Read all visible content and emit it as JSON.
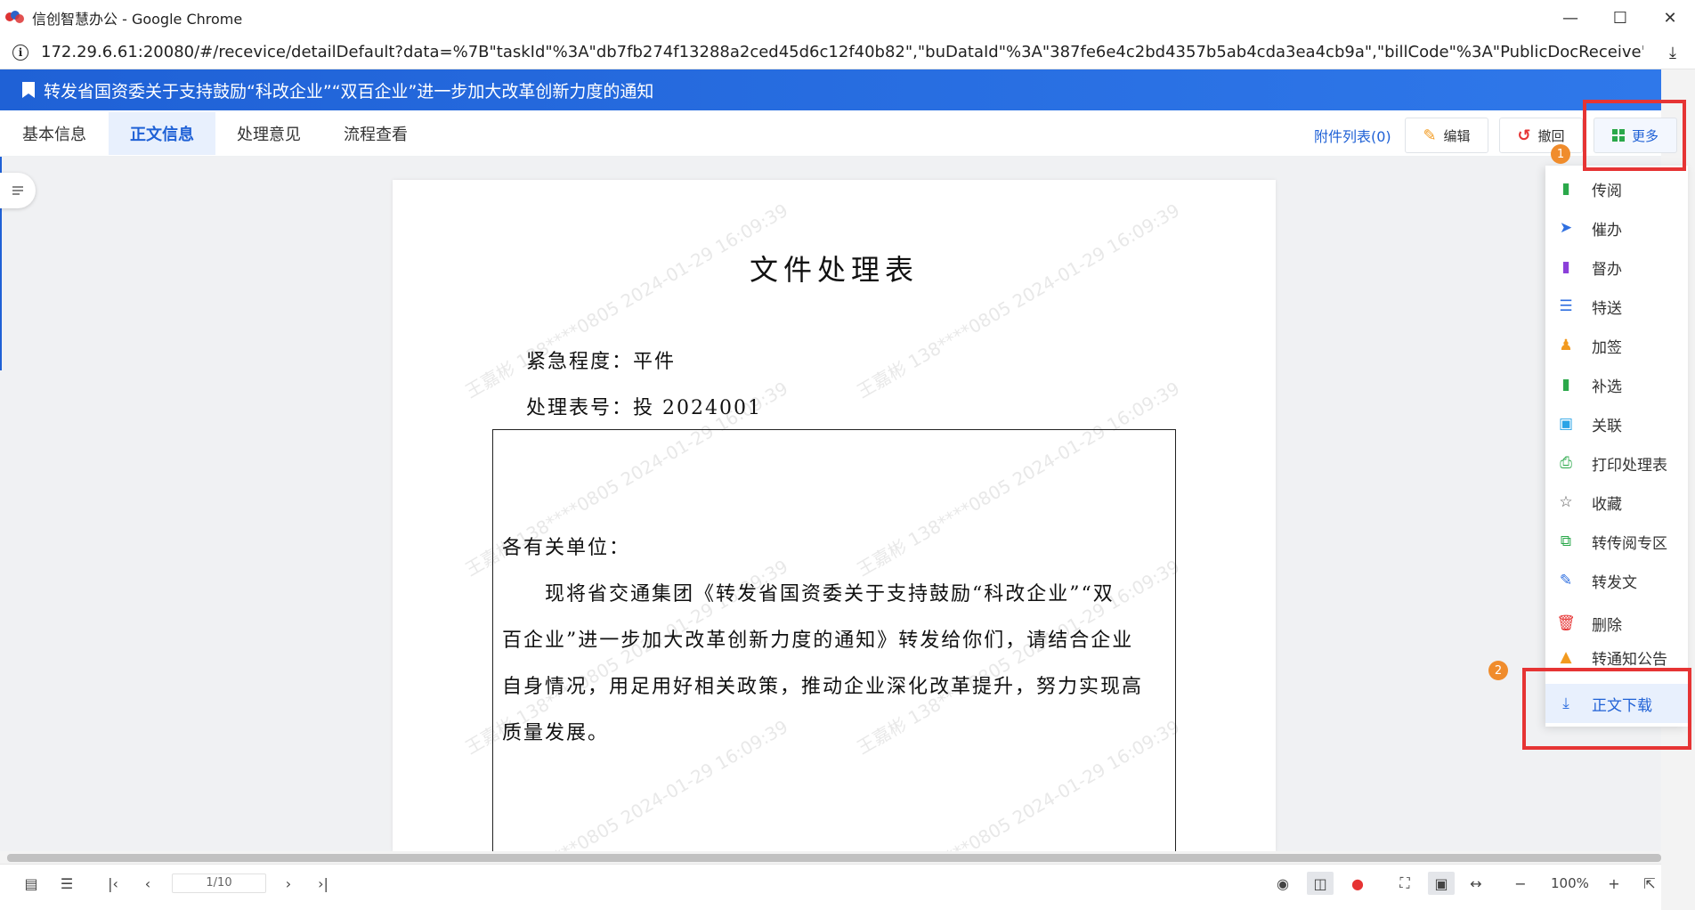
{
  "window": {
    "title": "信创智慧办公 - Google Chrome",
    "url": "172.29.6.61:20080/#/recevice/detailDefault?data=%7B\"taskId\"%3A\"db7fb274f13288a2ced45d6c12f40b82\",\"buDataId\"%3A\"387fe6e4c2bd4357b5ab4cda3ea4cb9a\",\"billCode\"%3A\"PublicDocReceive\",\"isOnlyRead\"..."
  },
  "header": {
    "title": "转发省国资委关于支持鼓励“科改企业”“双百企业”进一步加大改革创新力度的通知"
  },
  "tabs": [
    {
      "label": "基本信息"
    },
    {
      "label": "正文信息"
    },
    {
      "label": "处理意见"
    },
    {
      "label": "流程查看"
    }
  ],
  "toolbar": {
    "attachments_label": "附件列表(0)",
    "edit_label": "编辑",
    "withdraw_label": "撤回",
    "more_label": "更多"
  },
  "document": {
    "title": "文件处理表",
    "urgency": "紧急程度：平件",
    "form_number": "处理表号：投 2024001",
    "salutation": "各有关单位：",
    "body_lines": [
      "现将省交通集团《转发省国资委关于支持鼓励“科改企业”“双",
      "百企业”进一步加大改革创新力度的通知》转发给你们，请结合企业",
      "自身情况，用足用好相关政策，推动企业深化改革提升，努力实现高",
      "质量发展。"
    ],
    "watermark": "王嘉彬 138****0805 2024-01-29 16:09:39"
  },
  "menu": {
    "items": [
      {
        "label": "传阅",
        "icon": "circulate-icon",
        "color": "#2aa84a"
      },
      {
        "label": "催办",
        "icon": "urge-icon",
        "color": "#2f6fe0"
      },
      {
        "label": "督办",
        "icon": "supervise-icon",
        "color": "#8b3fd9"
      },
      {
        "label": "特送",
        "icon": "special-send-icon",
        "color": "#2f6fe0"
      },
      {
        "label": "加签",
        "icon": "add-signer-icon",
        "color": "#f29a1f"
      },
      {
        "label": "补选",
        "icon": "supplement-icon",
        "color": "#2aa84a"
      },
      {
        "label": "关联",
        "icon": "link-icon",
        "color": "#2ba4e6"
      },
      {
        "label": "打印处理表",
        "icon": "print-icon",
        "color": "#2aa84a"
      },
      {
        "label": "收藏",
        "icon": "star-icon",
        "color": "#555555"
      },
      {
        "label": "转传阅专区",
        "icon": "transfer-icon",
        "color": "#2aa84a"
      },
      {
        "label": "转发文",
        "icon": "forward-doc-icon",
        "color": "#2f6fe0"
      },
      {
        "label": "删除",
        "icon": "delete-icon",
        "color": "#e63434"
      },
      {
        "label": "转通知公告",
        "icon": "notice-icon",
        "color": "#f29a1f"
      },
      {
        "label": "正文下载",
        "icon": "download-icon",
        "color": "#2f6fe0"
      }
    ]
  },
  "pager": {
    "page": "1/10",
    "zoom": "100%"
  },
  "annotations": {
    "badge_1": "1",
    "badge_2": "2",
    "box_color": "#e63434"
  }
}
